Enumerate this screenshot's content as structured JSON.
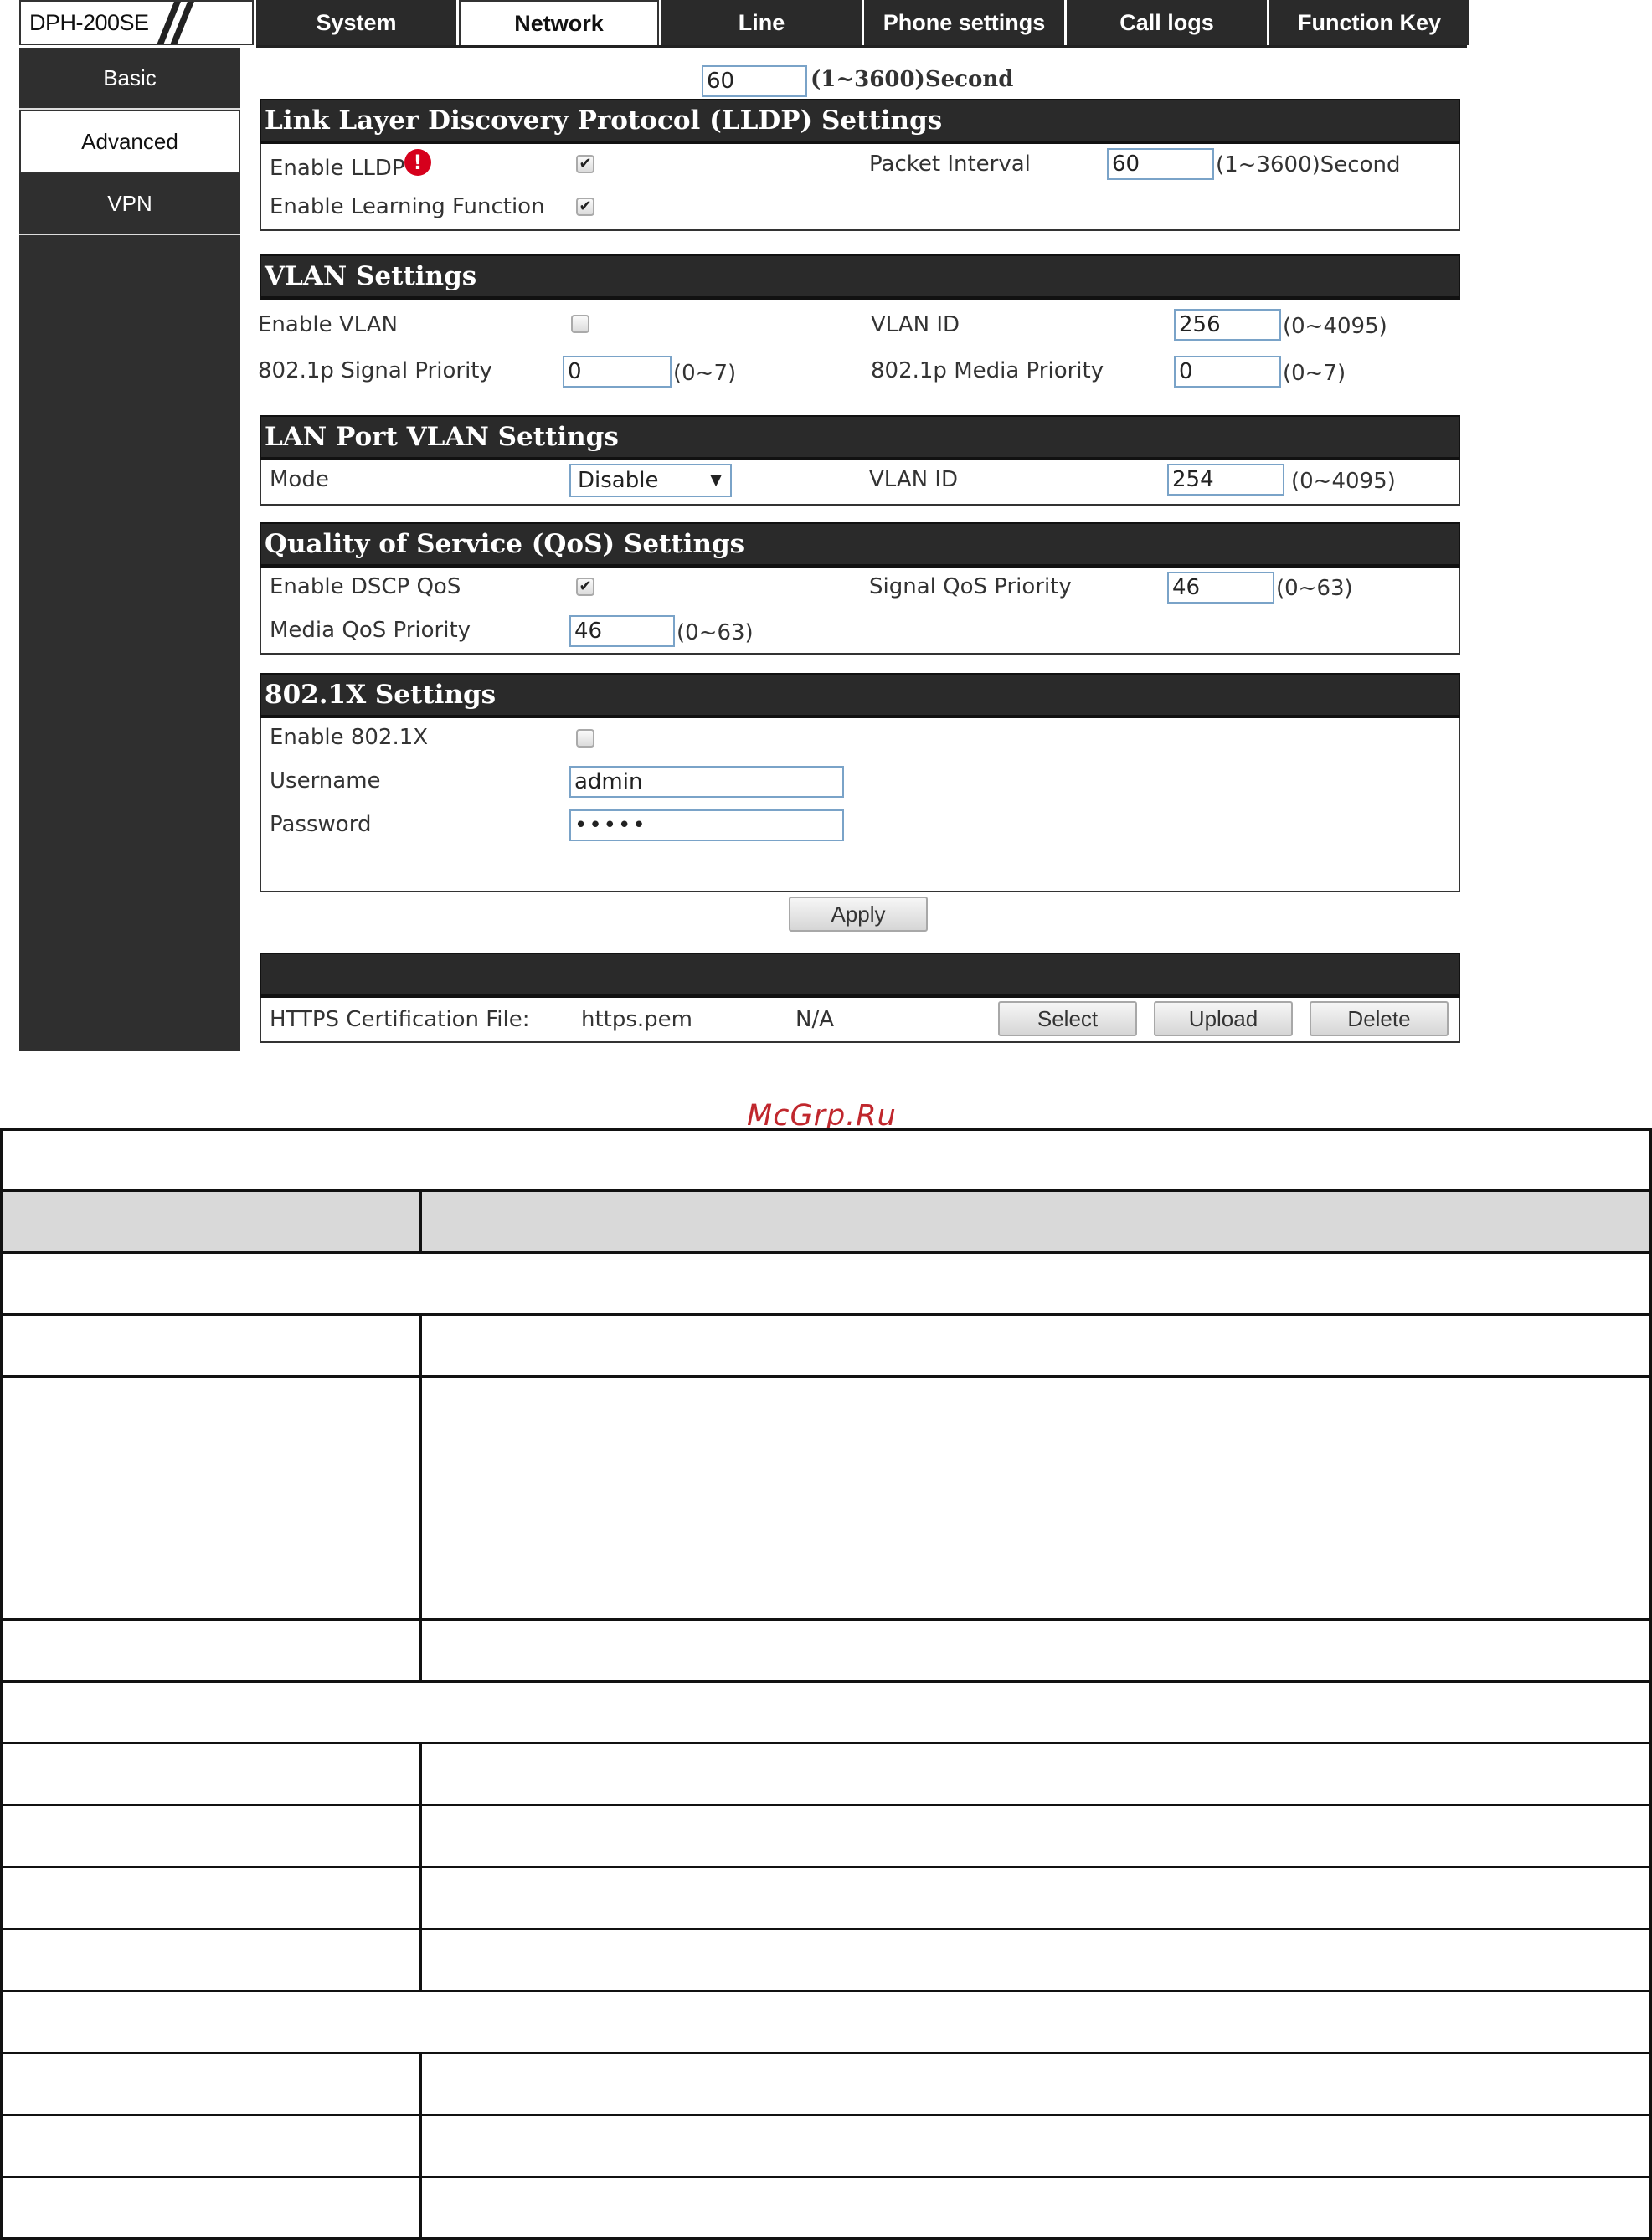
{
  "logo": {
    "model": "DPH-200SE"
  },
  "nav": {
    "tabs": [
      "System",
      "Network",
      "Line",
      "Phone settings",
      "Call logs",
      "Function Key"
    ],
    "active_index": 1
  },
  "sidebar": {
    "items": [
      "Basic",
      "Advanced",
      "VPN"
    ],
    "active_index": 1
  },
  "top_row": {
    "value": "60",
    "hint": "(1~3600)Second"
  },
  "lldp": {
    "title": "Link Layer Discovery Protocol (LLDP) Settings",
    "enable_label": "Enable LLDP",
    "enable_checked": true,
    "learning_label": "Enable Learning Function",
    "learning_checked": true,
    "interval_label": "Packet Interval",
    "interval_value": "60",
    "interval_hint": "(1~3600)Second"
  },
  "vlan": {
    "title": "VLAN Settings",
    "enable_label": "Enable VLAN",
    "enable_checked": false,
    "id_label": "VLAN ID",
    "id_value": "256",
    "id_hint": "(0~4095)",
    "signal_label": "802.1p Signal Priority",
    "signal_value": "0",
    "signal_hint": "(0~7)",
    "media_label": "802.1p Media Priority",
    "media_value": "0",
    "media_hint": "(0~7)"
  },
  "lan_vlan": {
    "title": "LAN Port VLAN Settings",
    "mode_label": "Mode",
    "mode_value": "Disable",
    "id_label": "VLAN ID",
    "id_value": "254",
    "id_hint": "(0~4095)"
  },
  "qos": {
    "title": "Quality of Service (QoS) Settings",
    "dscp_label": "Enable DSCP QoS",
    "dscp_checked": true,
    "signal_label": "Signal QoS Priority",
    "signal_value": "46",
    "signal_hint": "(0~63)",
    "media_label": "Media QoS Priority",
    "media_value": "46",
    "media_hint": "(0~63)"
  },
  "dot1x": {
    "title": "802.1X Settings",
    "enable_label": "Enable 802.1X",
    "enable_checked": false,
    "username_label": "Username",
    "username_value": "admin",
    "password_label": "Password",
    "password_value": "•••••"
  },
  "apply_label": "Apply",
  "https": {
    "label": "HTTPS Certification File:",
    "file": "https.pem",
    "status": "N/A",
    "select_label": "Select",
    "upload_label": "Upload",
    "delete_label": "Delete"
  },
  "watermark": "McGrp.Ru",
  "colors": {
    "nav_dark": "#2a2a2a",
    "sidebar": "#2f2f2f",
    "input_border": "#7aa3c8",
    "warning": "#d6001c",
    "watermark": "#c0272d",
    "table_header": "#d9d9d9"
  }
}
